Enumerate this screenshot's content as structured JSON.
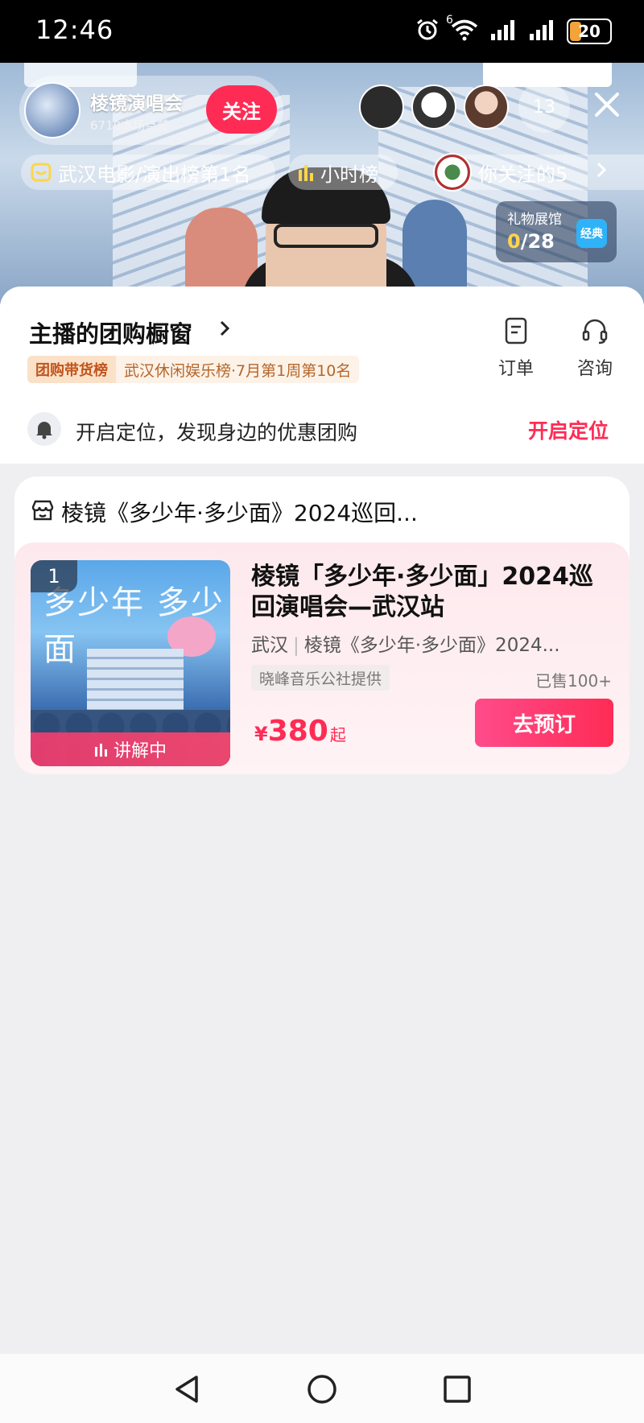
{
  "status_bar": {
    "time": "12:46",
    "network_label": "6",
    "battery": "20"
  },
  "live": {
    "anchor_name": "棱镜演唱会",
    "anchor_likes": "6710本场点赞",
    "follow_label": "关注",
    "viewer_count": "13",
    "rank_primary": "武汉电影/演出榜第1名",
    "rank_hourly": "小时榜",
    "rank_followed": "你关注的5",
    "gift_hall_title": "礼物展馆",
    "gift_progress_current": "0",
    "gift_progress_total": "/28",
    "gift_badge": "经典"
  },
  "shop": {
    "title": "主播的团购橱窗",
    "tag_label": "团购带货榜",
    "tag_text": "武汉休闲娱乐榜·7月第1周第10名",
    "action_order": "订单",
    "action_consult": "咨询",
    "location_prompt": "开启定位，发现身边的优惠团购",
    "location_button": "开启定位"
  },
  "product_card": {
    "store_title": "棱镜《多少年·多少面》2024巡回...",
    "rank": "1",
    "explaining_label": "讲解中",
    "name": "棱镜「多少年·多少面」2024巡回演唱会—武汉站",
    "city": "武汉",
    "subtitle": "棱镜《多少年·多少面》2024...",
    "provider": "晓峰音乐公社提供",
    "sold": "已售100+",
    "price_symbol": "¥",
    "price": "380",
    "price_suffix": "起",
    "book_button": "去预订",
    "poster_text": "多少年 多少面"
  },
  "colors": {
    "accent": "#fe2c55",
    "rank_tag": "#c1541c",
    "page_bg": "#efeff1"
  },
  "icons": {
    "alarm": "alarm-icon",
    "wifi": "wifi-icon",
    "signal": "signal-icon",
    "close": "close-icon",
    "chevron": "chevron-right-icon",
    "order": "document-icon",
    "consult": "headset-icon",
    "bell": "bell-icon",
    "store": "store-icon",
    "nav_back": "triangle-back-icon",
    "nav_home": "circle-home-icon",
    "nav_recent": "square-recent-icon"
  }
}
